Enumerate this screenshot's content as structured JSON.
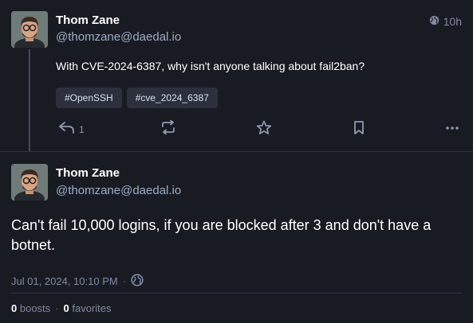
{
  "post": {
    "author_name": "Thom Zane",
    "author_handle": "@thomzane@daedal.io",
    "time": "10h",
    "text": "With CVE-2024-6387, why isn't anyone talking about fail2ban?",
    "tags": [
      "#OpenSSH",
      "#cve_2024_6387"
    ],
    "reply_count": "1",
    "icons": {
      "visibility": "globe-icon",
      "reply": "reply-icon",
      "boost": "boost-icon",
      "favorite": "star-icon",
      "bookmark": "bookmark-icon",
      "more": "more-icon"
    }
  },
  "reply": {
    "author_name": "Thom Zane",
    "author_handle": "@thomzane@daedal.io",
    "text": "Can't fail 10,000 logins, if you are blocked after 3 and don't have a botnet.",
    "datetime": "Jul 01, 2024, 10:10 PM",
    "separator": "·",
    "boosts_count": "0",
    "boosts_label": "boosts",
    "favorites_count": "0",
    "favorites_label": "favorites"
  },
  "colors": {
    "background": "#191b22",
    "secondary_text": "#9baec8",
    "tag_background": "#2c303d"
  }
}
